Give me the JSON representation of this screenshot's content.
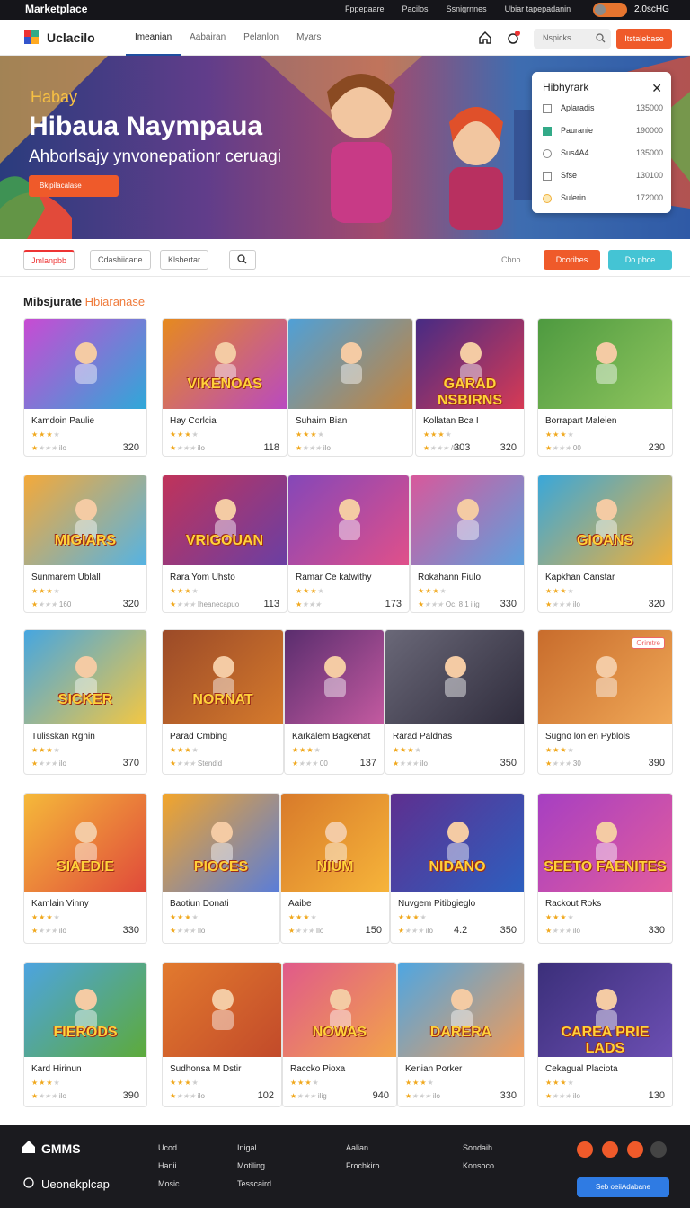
{
  "topbar": {
    "brand": "Marketplace",
    "links": [
      "Fppepaare",
      "Pacilos",
      "Ssnigrnnes",
      "Ubiar tapepadanin"
    ],
    "toggle_value": "2.0scHG"
  },
  "nav": {
    "logo_text": "Uclacilo",
    "tabs": [
      "Imeanian",
      "Aabairan",
      "Pelanlon",
      "Myars"
    ],
    "search_placeholder": "Nspicks",
    "cta": "Itstalebase"
  },
  "hero": {
    "kicker": "Habay",
    "title": "Hibaua Naympaua",
    "subtitle": "Ahborlsajy ynvonepationr ceruagi",
    "button": "Bkipilacalase"
  },
  "panel": {
    "title": "Hibhyrark",
    "rows": [
      {
        "label": "Aplaradis",
        "value": "135000"
      },
      {
        "label": "Pauranie",
        "value": "190000"
      },
      {
        "label": "Sus4A4",
        "value": "135000"
      },
      {
        "label": "Sfse",
        "value": "130100"
      },
      {
        "label": "Sulerin",
        "value": "172000"
      }
    ]
  },
  "filters": {
    "chip1": "Jmlanpbb",
    "chip2": "Cdashiicane",
    "chip3": "Klsbertar",
    "right_label": "Cbno",
    "btn1": "Dcoribes",
    "btn2": "Do pbce"
  },
  "section_title_a": "Mibsjurate",
  "section_title_b": "Hbiaranase",
  "cards": [
    {
      "title": "Kamdoin Paulie",
      "meta": "ilo",
      "price": "320",
      "color1": "#c84bd3",
      "color2": "#2fa8d8"
    },
    {
      "title": "Hay Corlcia",
      "meta": "ilo",
      "price": "118",
      "color1": "#e68a1e",
      "color2": "#b94ac0",
      "mark": "VIKENOAS"
    },
    {
      "title": "Suhairn Bian",
      "meta": "ilo",
      "price": "",
      "color1": "#4fa0d7",
      "color2": "#c7833a"
    },
    {
      "title": "Kollatan Bca I",
      "meta": "/80",
      "price": "320",
      "color1": "#472b84",
      "color2": "#d63a55",
      "mark": "GARAD NSBIRNS",
      "prev": "303"
    },
    {
      "title": "Borrapart Maleien",
      "meta": "00",
      "price": "230",
      "color1": "#4e9a40",
      "color2": "#8fc55e"
    },
    {
      "title": "Sunmarem Ublall",
      "meta": "160",
      "price": "320",
      "color1": "#f4a93a",
      "color2": "#55b3e3",
      "mark": "MIGIARS"
    },
    {
      "title": "Rara Yom Uhsto",
      "meta": "Iheanecapuo",
      "price": "113",
      "color1": "#c0335a",
      "color2": "#6b3fa3",
      "mark": "VRIGOUAN"
    },
    {
      "title": "Ramar Ce katwithy",
      "meta": "",
      "price": "173",
      "color1": "#8547b8",
      "color2": "#e0508a"
    },
    {
      "title": "Rokahann Fiulo",
      "meta": "Oc. 8 1 ilig",
      "price": "330",
      "color1": "#d8589b",
      "color2": "#5ea0dd"
    },
    {
      "title": "Kapkhan Canstar",
      "meta": "ilo",
      "price": "320",
      "color1": "#3aa7d9",
      "color2": "#f0b03a",
      "mark": "GIOANS"
    },
    {
      "title": "Tulisskan Rgnin",
      "meta": "ilo",
      "price": "370",
      "color1": "#46a6e0",
      "color2": "#f3c743",
      "mark": "SICKER"
    },
    {
      "title": "Parad Cmbing",
      "meta": "Stendid",
      "price": "",
      "color1": "#9b4a28",
      "color2": "#d57a2c",
      "mark": "NORNAT"
    },
    {
      "title": "Karkalem Bagkenat",
      "meta": "00",
      "price": "137",
      "color1": "#5a2d6e",
      "color2": "#c35aa0"
    },
    {
      "title": "Rarad Paldnas",
      "meta": "ilo",
      "price": "350",
      "color1": "#6a6878",
      "color2": "#2f2c3c"
    },
    {
      "title": "Sugno lon en Pyblols",
      "meta": "30",
      "price": "390",
      "color1": "#c86c2c",
      "color2": "#f0a857",
      "badge": "Orimtre"
    },
    {
      "title": "Kamlain Vinny",
      "meta": "ilo",
      "price": "330",
      "color1": "#f5b93a",
      "color2": "#e04a3a",
      "mark": "SIAEDIE"
    },
    {
      "title": "Baotiun Donati",
      "meta": "Ilo",
      "price": "",
      "color1": "#f3a52a",
      "color2": "#5a7dd8",
      "mark": "PIOCES"
    },
    {
      "title": "Aaibe",
      "meta": "Ilo",
      "price": "150",
      "color1": "#d87a2a",
      "color2": "#f6b43a",
      "mark": "NIUM"
    },
    {
      "title": "Nuvgem Pitibgieglo",
      "meta": "ilo",
      "price": "350",
      "color1": "#5e2f8f",
      "color2": "#2d5fbf",
      "mark": "NIDANO",
      "prev": "4.2"
    },
    {
      "title": "Rackout Roks",
      "meta": "ilo",
      "price": "330",
      "color1": "#a63fc2",
      "color2": "#e25c9e",
      "mark": "SEETO FAENITES"
    },
    {
      "title": "Kard Hirinun",
      "meta": "ilo",
      "price": "390",
      "color1": "#4da4e0",
      "color2": "#5daa3a",
      "mark": "FIERODS"
    },
    {
      "title": "Sudhonsa M Dstir",
      "meta": "ilo",
      "price": "102",
      "color1": "#e27a2e",
      "color2": "#c24a2a"
    },
    {
      "title": "Raccko Pioxa",
      "meta": "ilig",
      "price": "940",
      "color1": "#e05a8a",
      "color2": "#f2a34a",
      "mark": "NOWAS"
    },
    {
      "title": "Kenian Porker",
      "meta": "ilo",
      "price": "330",
      "color1": "#4ea6e2",
      "color2": "#ef9b5a",
      "mark": "DARERA"
    },
    {
      "title": "Cekagual Placiota",
      "meta": "ilo",
      "price": "130",
      "color1": "#3b2f7a",
      "color2": "#6c4fb3",
      "mark": "CAREA PRIE LADS"
    }
  ],
  "footer": {
    "brand": "GMMS",
    "tagline": "Ueonekplcap",
    "cols": [
      [
        "Ucod",
        "Hanii",
        "Mosic"
      ],
      [
        "Inigal",
        "Motiling",
        "Tesscaird"
      ],
      [
        "Aalian",
        "Frochkiro"
      ],
      [
        "Sondaih",
        "Konsoco"
      ]
    ],
    "button": "Seb oeiiAdabane"
  }
}
